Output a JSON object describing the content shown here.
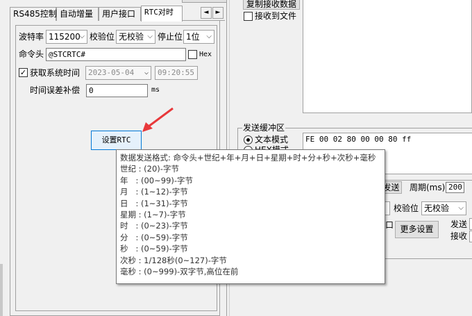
{
  "top_partial": {
    "left_text": "",
    "right_btn": "",
    "menu_btn": ""
  },
  "tabs": [
    {
      "label": "RS485控制"
    },
    {
      "label": "自动增量"
    },
    {
      "label": "用户接口"
    },
    {
      "label": "RTC对时",
      "active": true
    }
  ],
  "tab_arrows": {
    "left": "◄",
    "right": "►"
  },
  "rtc": {
    "baud_label": "波特率",
    "baud_value": "115200",
    "parity_label": "校验位",
    "parity_value": "无校验",
    "stop_label": "停止位",
    "stop_value": "1位",
    "cmd_label": "命令头",
    "cmd_value": "@STCRTC#",
    "hex_label": "Hex",
    "hex_checked": false,
    "sys_time_label": "获取系统时间",
    "sys_time_checked": true,
    "date_value": "2023-05-04",
    "time_value": "09:20:55",
    "comp_label": "时间误差补偿",
    "comp_value": "0",
    "comp_unit": "ms",
    "set_button": "设置RTC"
  },
  "right": {
    "copy_button": "复制接收数据",
    "save_file_label": "接收到文件",
    "send_buffer_label": "发送缓冲区",
    "text_mode_label": "文本模式",
    "hex_mode_label": "HEX模式",
    "send_content": "FE 00 02 80 00 00 80 ff",
    "auto_send_label": "发送",
    "period_label": "周期(ms)",
    "period_value": "200",
    "parity_label": "校验位",
    "parity_value": "无校验",
    "port_partial": "口",
    "more_button": "更多设置",
    "send_label": "发送",
    "recv_label": "接收"
  },
  "tooltip": {
    "lines": [
      "数据发送格式: 命令头+世纪+年+月+日+星期+时+分+秒+次秒+毫秒",
      "世纪 : (20)-字节",
      "年   : (00~99)-字节",
      "月   : (1~12)-字节",
      "日   : (1~31)-字节",
      "星期 : (1~7)-字节",
      "时   : (0~23)-字节",
      "分   : (0~59)-字节",
      "秒   : (0~59)-字节",
      "次秒 : 1/128秒(0~127)-字节",
      "毫秒 : (0~999)-双字节,高位在前"
    ]
  },
  "colors": {
    "arrow": "#e8383a",
    "border": "#a0a0a0",
    "focus": "#0078d7"
  }
}
